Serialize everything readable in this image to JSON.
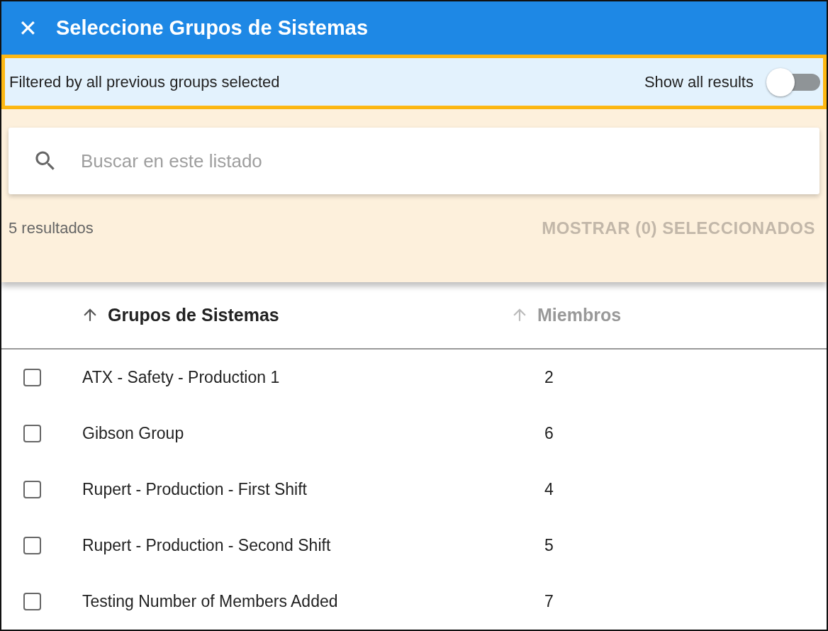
{
  "dialog": {
    "close_icon": "✕",
    "title": "Seleccione Grupos de Sistemas"
  },
  "filter_bar": {
    "message": "Filtered by all previous groups selected",
    "toggle_label": "Show all results",
    "toggle_on": false
  },
  "search": {
    "placeholder": "Buscar en este listado"
  },
  "results": {
    "count": "5 resultados",
    "show_selected_button": "MOSTRAR (0) SELECCIONADOS",
    "show_selected_disabled": true
  },
  "table": {
    "columns": [
      {
        "label": "Grupos de Sistemas",
        "sort_active": true
      },
      {
        "label": "Miembros",
        "sort_active": false
      }
    ],
    "rows": [
      {
        "name": "ATX - Safety - Production 1",
        "members": "2",
        "checked": false
      },
      {
        "name": "Gibson Group",
        "members": "6",
        "checked": false
      },
      {
        "name": "Rupert - Production - First Shift",
        "members": "4",
        "checked": false
      },
      {
        "name": "Rupert - Production - Second Shift",
        "members": "5",
        "checked": false
      },
      {
        "name": "Testing Number of Members Added",
        "members": "7",
        "checked": false
      }
    ]
  }
}
